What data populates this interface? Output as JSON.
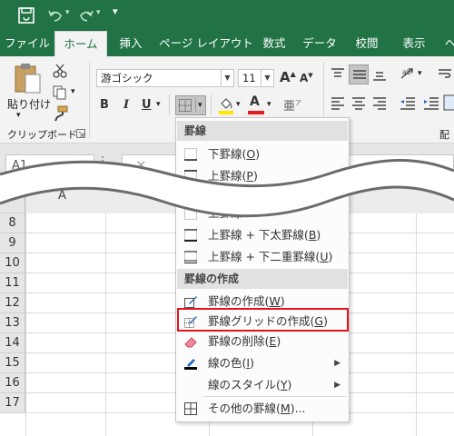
{
  "titlebar": {
    "save_icon": "save-icon",
    "undo_icon": "undo-icon",
    "redo_icon": "redo-icon",
    "customize": "▾"
  },
  "tabs": [
    "ファイル",
    "ホーム",
    "挿入",
    "ページ レイアウト",
    "数式",
    "データ",
    "校閲",
    "表示",
    "ヘ"
  ],
  "ribbon": {
    "paste_label": "貼り付け",
    "clipboard_label": "クリップボード",
    "font_name": "游ゴシック",
    "font_size": "11",
    "bold": "B",
    "italic": "I",
    "underline": "U",
    "font_color_letter": "A",
    "grow_font": "A",
    "shrink_font": "A",
    "partial_label": "配"
  },
  "namebox": {
    "value": "A1"
  },
  "cancel_symbol": "✕",
  "grid": {
    "col_header_partial": "A",
    "rows": [
      "8",
      "9",
      "10",
      "11",
      "12",
      "13",
      "14",
      "15",
      "16",
      "17"
    ]
  },
  "menu": {
    "section_borders": "罫線",
    "items_top": [
      {
        "label": "下罫線",
        "key": "O"
      },
      {
        "label": "上罫線",
        "key": "P"
      }
    ],
    "items_mid": [
      {
        "label": "上罫線",
        "key": ""
      },
      {
        "label": "上罫線 + 下太罫線",
        "key": "B"
      },
      {
        "label": "上罫線 + 下二重罫線",
        "key": "U"
      }
    ],
    "section_draw": "罫線の作成",
    "items_draw": [
      {
        "label": "罫線の作成",
        "key": "W"
      },
      {
        "label": "罫線グリッドの作成",
        "key": "G"
      },
      {
        "label": "罫線の削除",
        "key": "E"
      },
      {
        "label": "線の色",
        "key": "I"
      },
      {
        "label": "線のスタイル",
        "key": "Y"
      },
      {
        "label": "その他の罫線",
        "key": "M",
        "suffix": "..."
      }
    ]
  },
  "colors": {
    "excel_green": "#217346",
    "highlight_red": "#e3131b",
    "font_red": "#e31b1b",
    "fill_yellow": "#ffe800"
  }
}
